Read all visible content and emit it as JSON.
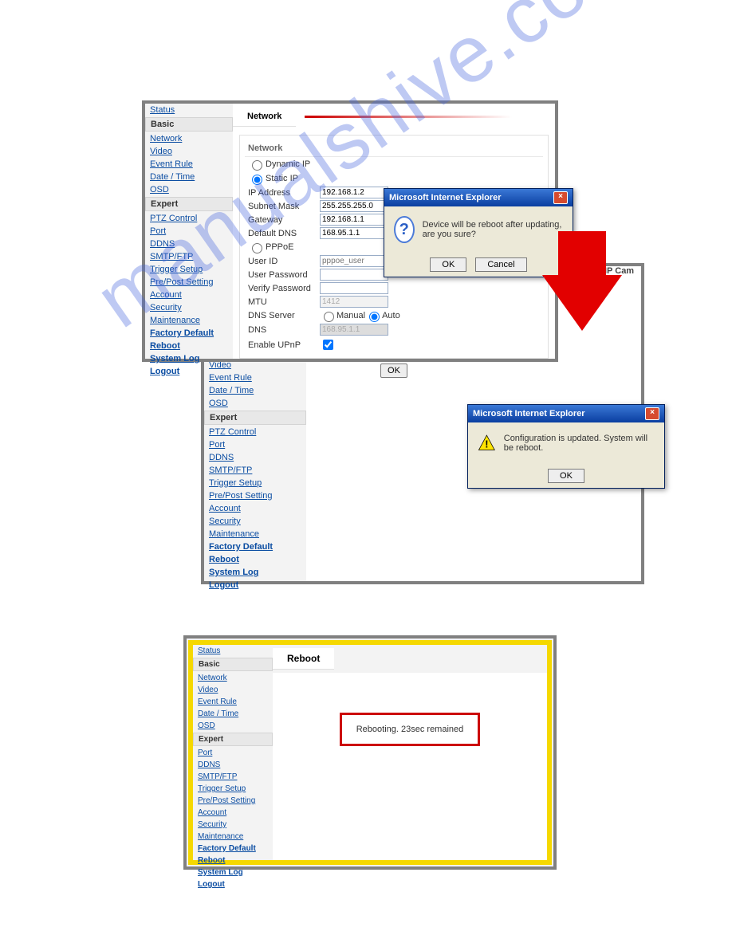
{
  "watermark": "manualshive.com",
  "panel1": {
    "sidebar": {
      "cats": [
        "Status",
        "Basic",
        "Expert"
      ],
      "basic": [
        "Network",
        "Video",
        "Event Rule",
        "Date / Time",
        "OSD"
      ],
      "expert": [
        "PTZ Control",
        "Port",
        "DDNS",
        "SMTP/FTP",
        "Trigger Setup",
        "Pre/Post Setting",
        "Account",
        "Security",
        "Maintenance",
        "Factory Default",
        "Reboot",
        "System Log",
        "Logout"
      ]
    },
    "tab": "Network",
    "section": "Network",
    "mode_dynamic": "Dynamic IP",
    "mode_static": "Static IP",
    "fields": {
      "ip_label": "IP Address",
      "ip": "192.168.1.2",
      "mask_label": "Subnet Mask",
      "mask": "255.255.255.0",
      "gw_label": "Gateway",
      "gw": "192.168.1.1",
      "dns_label": "Default DNS",
      "dns": "168.95.1.1",
      "pppoe": "PPPoE",
      "uid_label": "User ID",
      "uid_ph": "pppoe_user",
      "upw_label": "User Password",
      "vpw_label": "Verify Password",
      "mtu_label": "MTU",
      "mtu": "1412",
      "dnssrv_label": "DNS Server",
      "manual": "Manual",
      "auto": "Auto",
      "dns2_label": "DNS",
      "dns2": "168.95.1.1",
      "upnp": "Enable UPnP"
    },
    "ok": "OK"
  },
  "dialog1": {
    "title": "Microsoft Internet Explorer",
    "msg": "Device will be reboot after updating, are you sure?",
    "ok": "OK",
    "cancel": "Cancel"
  },
  "ipcam": "IP Cam",
  "panel2": {
    "sidebar": {
      "basic": [
        "Video",
        "Event Rule",
        "Date / Time",
        "OSD"
      ],
      "expert_label": "Expert",
      "expert": [
        "PTZ Control",
        "Port",
        "DDNS",
        "SMTP/FTP",
        "Trigger Setup",
        "Pre/Post Setting",
        "Account",
        "Security",
        "Maintenance",
        "Factory Default",
        "Reboot",
        "System Log",
        "Logout"
      ]
    }
  },
  "dialog2": {
    "title": "Microsoft Internet Explorer",
    "msg": "Configuration is updated. System will be reboot.",
    "ok": "OK"
  },
  "panel3": {
    "tab": "Reboot",
    "msg": "Rebooting. 23sec remained",
    "sidebar": {
      "cats": [
        "Status",
        "Basic",
        "Expert"
      ],
      "basic": [
        "Network",
        "Video",
        "Event Rule",
        "Date / Time",
        "OSD"
      ],
      "expert": [
        "Port",
        "DDNS",
        "SMTP/FTP",
        "Trigger Setup",
        "Pre/Post Setting",
        "Account",
        "Security",
        "Maintenance",
        "Factory Default",
        "Reboot",
        "System Log",
        "Logout"
      ]
    }
  }
}
